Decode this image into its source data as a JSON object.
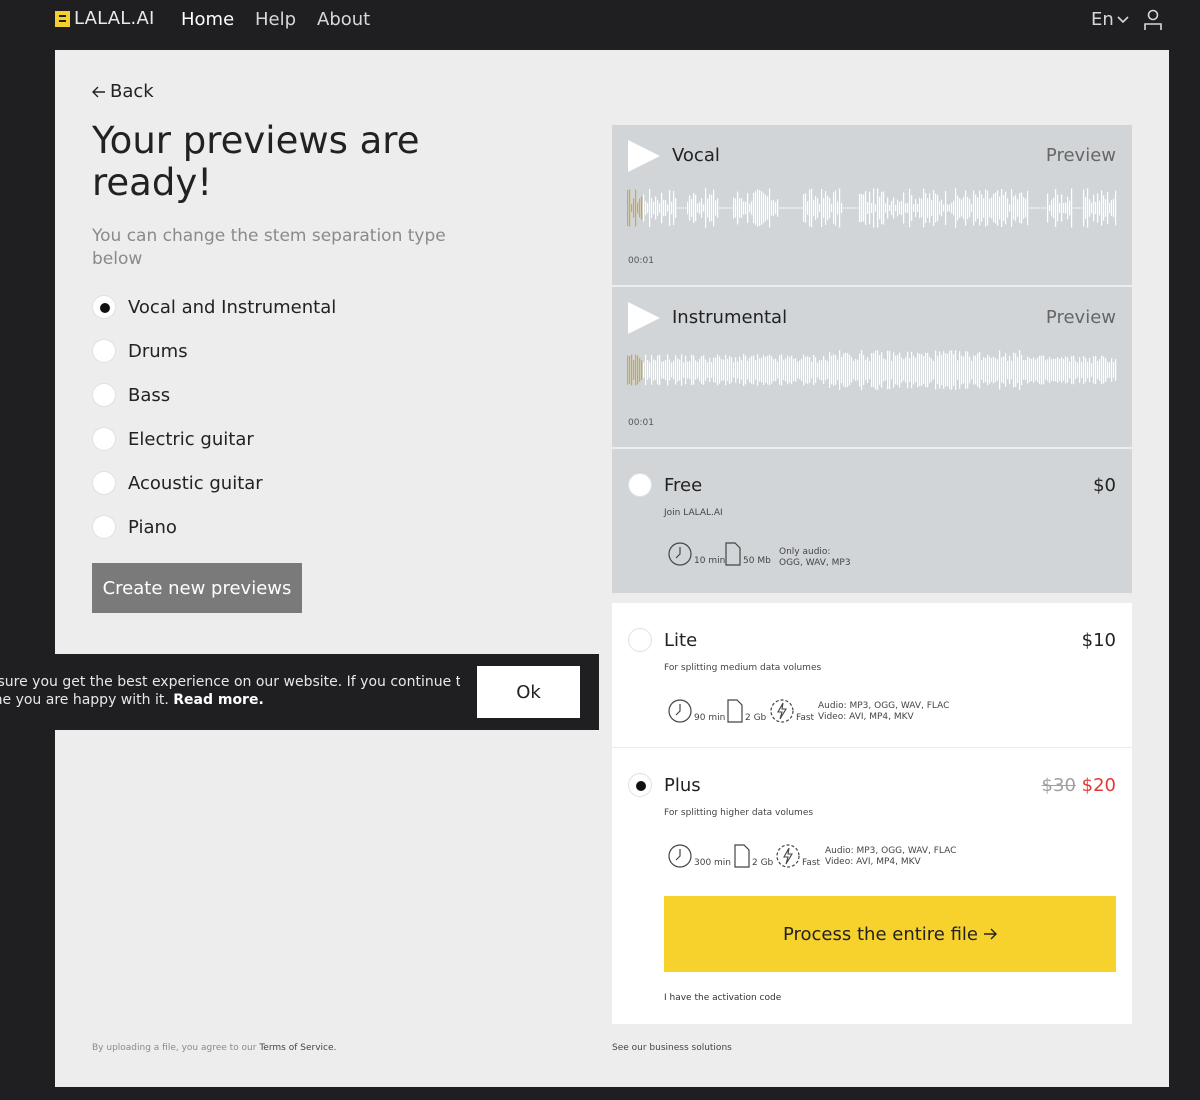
{
  "nav": {
    "logo_text": "LALAL.AI",
    "links": [
      "Home",
      "Help",
      "About"
    ],
    "lang": "En"
  },
  "main": {
    "back_label": "Back",
    "title": "Your previews are ready!",
    "subtitle": "You can change the stem separation type below",
    "options": [
      {
        "label": "Vocal and Instrumental",
        "checked": true
      },
      {
        "label": "Drums",
        "checked": false
      },
      {
        "label": "Bass",
        "checked": false
      },
      {
        "label": "Electric guitar",
        "checked": false
      },
      {
        "label": "Acoustic guitar",
        "checked": false
      },
      {
        "label": "Piano",
        "checked": false
      }
    ],
    "create_label": "Create new previews",
    "footer_text": "By uploading a file, you agree to our",
    "footer_link": "Terms of Service.",
    "footer_right": "See our business solutions"
  },
  "stems": [
    {
      "name": "Vocal",
      "preview_label": "Preview",
      "time": "00:01"
    },
    {
      "name": "Instrumental",
      "preview_label": "Preview",
      "time": "00:01"
    }
  ],
  "plans": {
    "free": {
      "name": "Free",
      "price": "$0",
      "desc": "Join LALAL.AI",
      "minutes": "10 min",
      "size": "50 Mb",
      "note": [
        "Only audio:",
        "OGG, WAV, MP3"
      ]
    },
    "lite": {
      "name": "Lite",
      "price": "$10",
      "desc": "For splitting medium data volumes",
      "minutes": "90 min",
      "size": "2 Gb",
      "speed": "Fast",
      "note": [
        "Audio: MP3, OGG, WAV, FLAC",
        "Video: AVI, MP4, MKV"
      ]
    },
    "plus": {
      "name": "Plus",
      "old_price": "$30",
      "price": "$20",
      "desc": "For splitting higher data volumes",
      "minutes": "300 min",
      "size": "2 Gb",
      "speed": "Fast",
      "note": [
        "Audio: MP3, OGG, WAV, FLAC",
        "Video: AVI, MP4, MKV"
      ]
    },
    "selected": "plus"
  },
  "process_label": "Process the entire file",
  "activation_label": "I have the activation code",
  "cookie": {
    "line1": "ensure you get the best experience on our website. If you continue to",
    "line2": "ume you are happy with it.",
    "read_more": "Read more.",
    "ok_label": "Ok"
  },
  "colors": {
    "background": "#1f1e21",
    "panel": "#ededed",
    "accent_yellow": "#f7d22c",
    "stem_card": "#d2d5d8",
    "sale_red": "#e53935"
  }
}
